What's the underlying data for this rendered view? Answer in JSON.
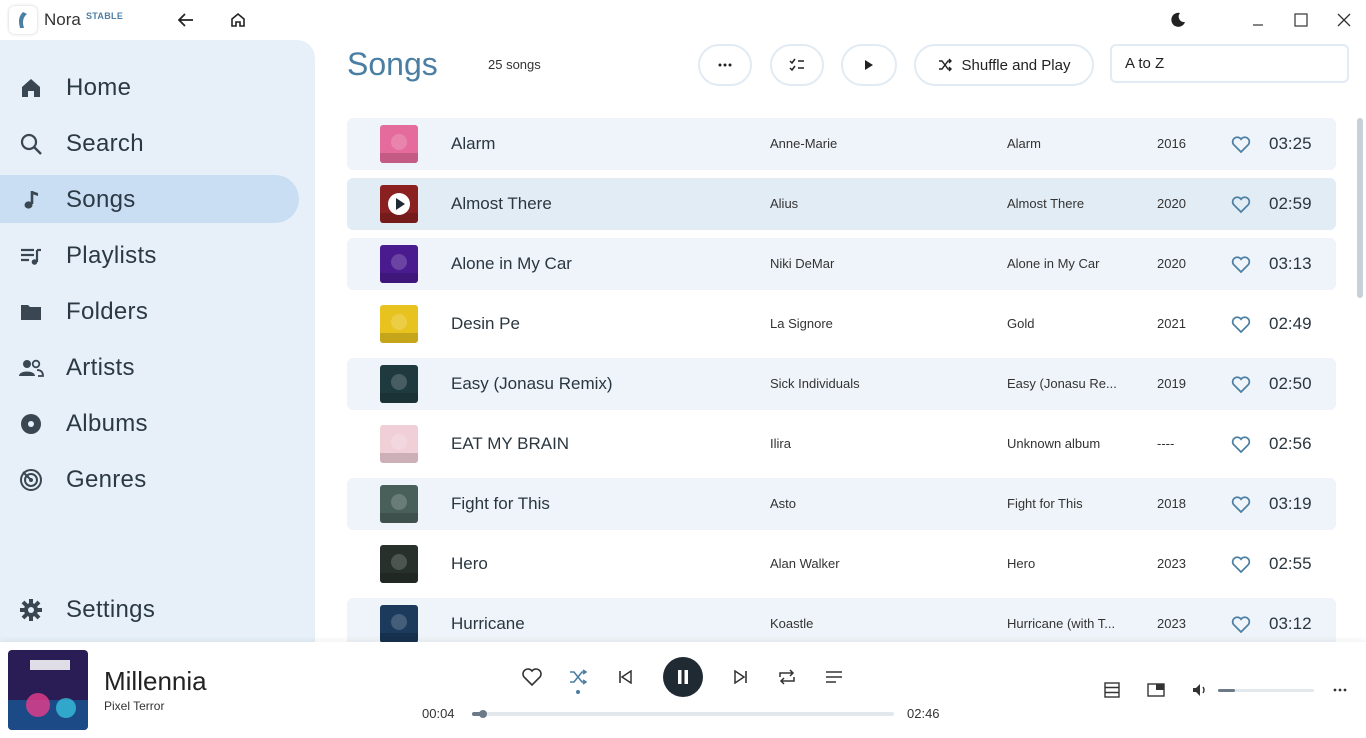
{
  "app": {
    "name": "Nora",
    "tag": "STABLE"
  },
  "sidebar": {
    "items": [
      {
        "label": "Home",
        "icon": "home-icon"
      },
      {
        "label": "Search",
        "icon": "search-icon"
      },
      {
        "label": "Songs",
        "icon": "music-note-icon",
        "active": true
      },
      {
        "label": "Playlists",
        "icon": "playlist-icon"
      },
      {
        "label": "Folders",
        "icon": "folder-icon"
      },
      {
        "label": "Artists",
        "icon": "people-icon"
      },
      {
        "label": "Albums",
        "icon": "album-icon"
      },
      {
        "label": "Genres",
        "icon": "genre-icon"
      }
    ],
    "settings": {
      "label": "Settings",
      "icon": "gear-icon"
    }
  },
  "header": {
    "title": "Songs",
    "count": "25 songs",
    "shuffle_play_label": "Shuffle and Play",
    "sort_value": "A to Z"
  },
  "songs": [
    {
      "title": "Alarm",
      "artist": "Anne-Marie",
      "album": "Alarm",
      "year": "2016",
      "duration": "03:25",
      "art_color": "#e56b9c"
    },
    {
      "title": "Almost There",
      "artist": "Alius",
      "album": "Almost There",
      "year": "2020",
      "duration": "02:59",
      "art_color": "#8a2020",
      "active": true
    },
    {
      "title": "Alone in My Car",
      "artist": "Niki DeMar",
      "album": "Alone in My Car",
      "year": "2020",
      "duration": "03:13",
      "art_color": "#4a1a8f"
    },
    {
      "title": "Desin Pe",
      "artist": "La Signore",
      "album": "Gold",
      "year": "2021",
      "duration": "02:49",
      "art_color": "#e8c21e"
    },
    {
      "title": "Easy (Jonasu Remix)",
      "artist": "Sick Individuals",
      "album": "Easy (Jonasu Re...",
      "year": "2019",
      "duration": "02:50",
      "art_color": "#1f3a3f"
    },
    {
      "title": "EAT MY BRAIN",
      "artist": "Ilira",
      "album": "Unknown album",
      "year": "----",
      "duration": "02:56",
      "art_color": "#f1cfd7"
    },
    {
      "title": "Fight for This",
      "artist": "Asto",
      "album": "Fight for This",
      "year": "2018",
      "duration": "03:19",
      "art_color": "#49605a"
    },
    {
      "title": "Hero",
      "artist": "Alan Walker",
      "album": "Hero",
      "year": "2023",
      "duration": "02:55",
      "art_color": "#27302b"
    },
    {
      "title": "Hurricane",
      "artist": "Koastle",
      "album": "Hurricane (with T...",
      "year": "2023",
      "duration": "03:12",
      "art_color": "#1b3a5c"
    }
  ],
  "player": {
    "title": "Millennia",
    "artist": "Pixel Terror",
    "current_time": "00:04",
    "total_time": "02:46",
    "progress": 0.025,
    "volume": 0.18,
    "art_color": "#3a2a6e"
  }
}
